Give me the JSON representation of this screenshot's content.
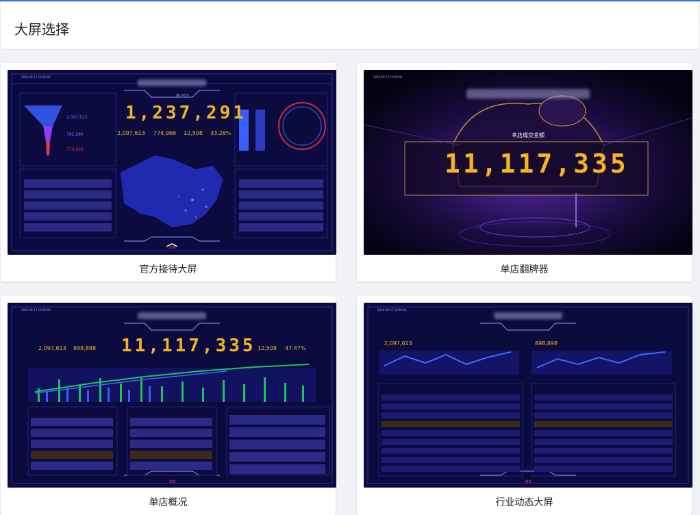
{
  "page": {
    "title": "大屏选择"
  },
  "screens": [
    {
      "caption": "官方接待大屏",
      "main_number": "1,237,291",
      "stats": [
        "2,097,613",
        "774,966",
        "12,508",
        "33.26%"
      ],
      "funnel_values": [
        "2,097,613",
        "782,286",
        "774,966"
      ],
      "timestamp": "2018-08-17 16:09:44",
      "top_ratio": "98.47%",
      "brand": "京东"
    },
    {
      "caption": "单店翻牌器",
      "main_number": "11,117,335",
      "label": "本店成交金额",
      "timestamp": "2018-08-17 16:09:44"
    },
    {
      "caption": "单店概况",
      "main_number": "11,117,335",
      "stats": [
        "2,097,613",
        "898,898",
        "12,508",
        "47.47%"
      ],
      "timestamp": "2018-08-17 16:09:44",
      "brand": "京东"
    },
    {
      "caption": "行业动态大屏",
      "stats": [
        "2,097,613",
        "898,898"
      ],
      "timestamp": "2018-08-17 16:09:44",
      "brand": "京东"
    }
  ],
  "colors": {
    "accent": "#2f6fe0",
    "screen_bg": "#0a0a3c",
    "number": "#f6b51d",
    "line_blue": "#3a6bff",
    "line_green": "#1fc35a"
  },
  "icons": [
    "refresh-icon",
    "fullscreen-icon",
    "jd-logo-icon"
  ]
}
